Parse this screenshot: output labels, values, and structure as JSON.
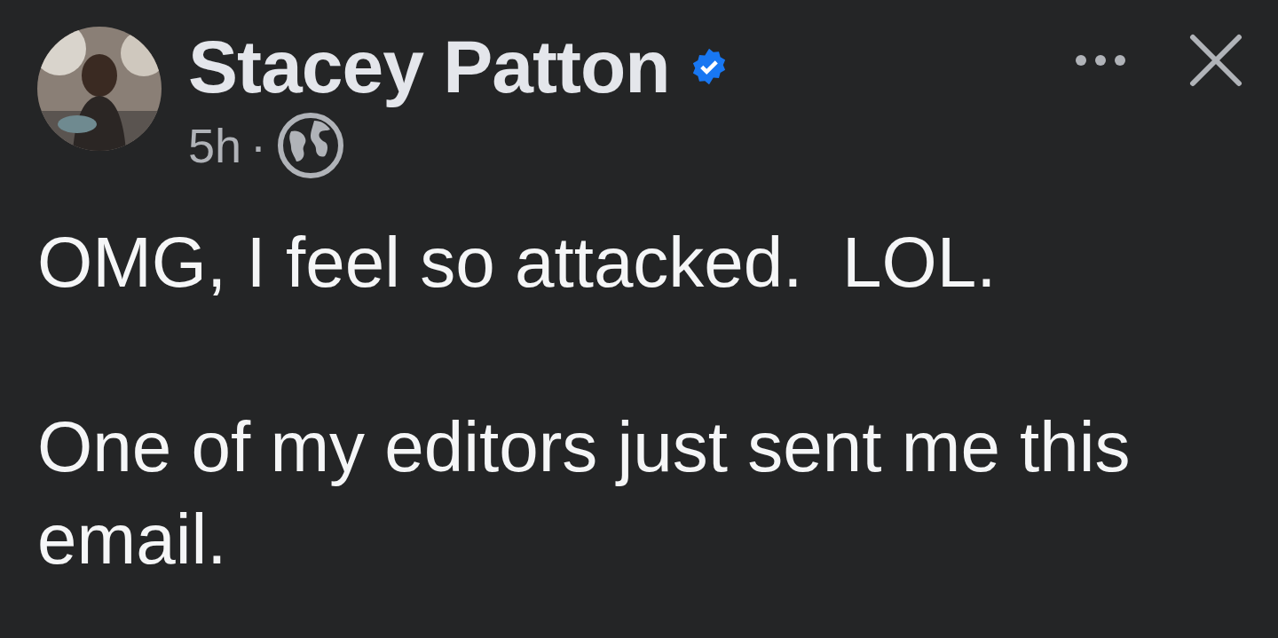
{
  "post": {
    "author": {
      "name": "Stacey Patton",
      "verified": true
    },
    "time": "5h",
    "separator": "·",
    "public": true,
    "paragraphs": [
      "OMG, I feel so attacked.  LOL.",
      "One of my editors just sent me this email."
    ]
  }
}
